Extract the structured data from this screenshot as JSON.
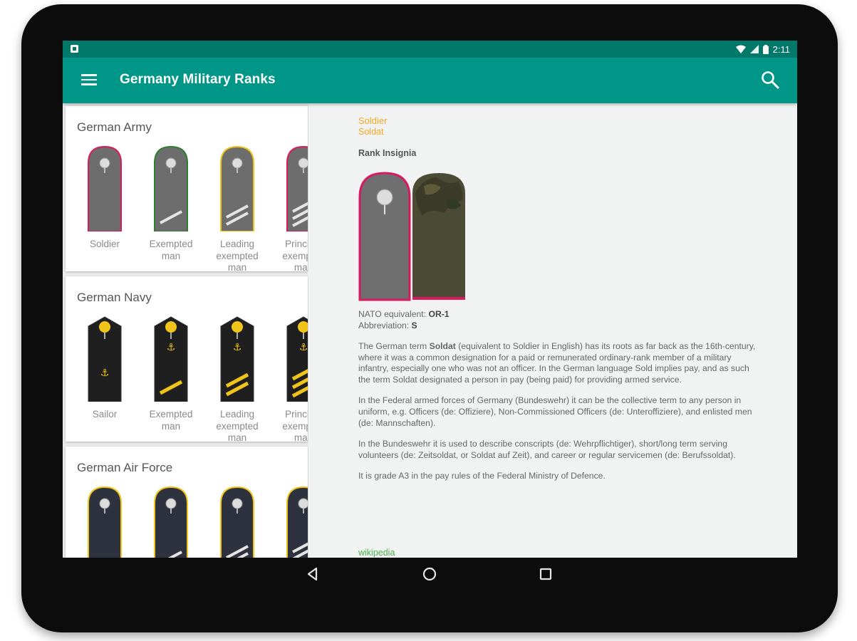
{
  "status": {
    "time": "2:11"
  },
  "app": {
    "title": "Germany Military Ranks"
  },
  "categories": [
    {
      "title": "German Army",
      "ranks": [
        "Soldier",
        "Exempted man",
        "Leading exempted man",
        "Principal exempted man"
      ]
    },
    {
      "title": "German Navy",
      "ranks": [
        "Sailor",
        "Exempted man",
        "Leading exempted man",
        "Principal exempted man"
      ]
    },
    {
      "title": "German Air Force",
      "ranks": [
        "",
        "",
        "",
        ""
      ]
    }
  ],
  "detail": {
    "rank_name": "Soldier",
    "rank_german": "Soldat",
    "insignia_heading": "Rank Insignia",
    "nato_label": "NATO equivalent:",
    "nato_value": "OR-1",
    "abbr_label": "Abbreviation:",
    "abbr_value": "S",
    "desc_p1_pre": "The German term ",
    "desc_p1_bold": "Soldat",
    "desc_p1_post": " (equivalent to Soldier in English) has its roots as far back as the 16th-century, where it was a common designation for a paid or remunerated ordinary-rank member of a military infantry, especially one who was not an officer. In the German language Sold implies pay, and as such the term Soldat designated a person in pay (being paid) for providing armed service.",
    "desc_p2": "In the Federal armed forces of Germany (Bundeswehr) it can be the collective term to any person in uniform, e.g. Officers (de: Offiziere), Non-Commissioned Officers (de: Unteroffiziere), and enlisted men (de: Mannschaften).",
    "desc_p3": "In the Bundeswehr it is used to describe conscripts (de: Wehrpflichtiger), short/long term serving volunteers (de: Zeitsoldat, or Soldat auf Zeit), and career or regular servicemen (de: Berufssoldat).",
    "desc_p4": "It is grade A3 in the pay rules of the Federal Ministry of Defence.",
    "source_link": "wikipedia"
  },
  "colors": {
    "primary": "#009688",
    "primary_dark": "#00796b",
    "accent": "#f5a623",
    "army_board": "#6d6d6d",
    "navy_board": "#1f1f1f",
    "airforce_board": "#2d323e",
    "gold": "#f0c419"
  },
  "icons": {
    "menu": "menu-icon",
    "search": "search-icon",
    "back": "back-icon",
    "home": "home-icon",
    "recents": "recents-icon"
  }
}
